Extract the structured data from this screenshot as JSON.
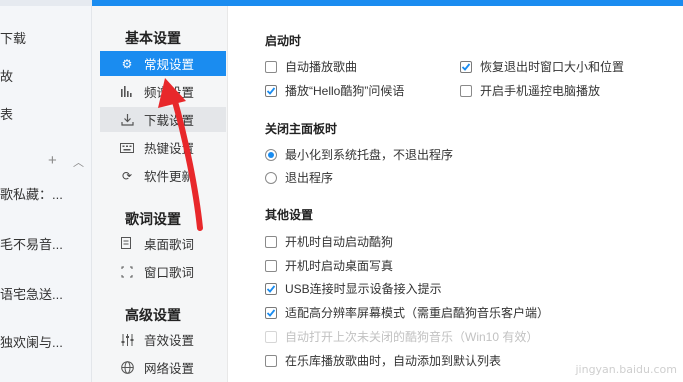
{
  "background_app": {
    "items": [
      "下载",
      "故",
      "表",
      "歌私藏：...",
      "毛不易音...",
      "语宅急送...",
      "独欢阑与..."
    ],
    "plus_icon": "plus-icon",
    "collapse_icon": "chevron-up-icon"
  },
  "sidebar": {
    "groups": [
      {
        "title": "基本设置",
        "items": [
          {
            "label": "常规设置",
            "icon": "gear-icon"
          },
          {
            "label": "频谱设置",
            "icon": "spectrum-icon"
          },
          {
            "label": "下载设置",
            "icon": "download-icon"
          },
          {
            "label": "热键设置",
            "icon": "keyboard-icon"
          },
          {
            "label": "软件更新",
            "icon": "refresh-icon"
          }
        ]
      },
      {
        "title": "歌词设置",
        "items": [
          {
            "label": "桌面歌词",
            "icon": "lyrics-desktop-icon"
          },
          {
            "label": "窗口歌词",
            "icon": "lyrics-window-icon"
          }
        ]
      },
      {
        "title": "高级设置",
        "items": [
          {
            "label": "音效设置",
            "icon": "equalizer-icon"
          },
          {
            "label": "网络设置",
            "icon": "network-icon"
          }
        ]
      }
    ],
    "active": "常规设置",
    "hovered": "下载设置"
  },
  "startup": {
    "title": "启动时",
    "options": [
      {
        "label": "自动播放歌曲",
        "checked": false
      },
      {
        "label": "恢复退出时窗口大小和位置",
        "checked": true
      },
      {
        "label": "播放“Hello酷狗”问候语",
        "checked": true
      },
      {
        "label": "开启手机遥控电脑播放",
        "checked": false
      }
    ]
  },
  "close_panel": {
    "title": "关闭主面板时",
    "options": [
      {
        "label": "最小化到系统托盘，不退出程序",
        "selected": true
      },
      {
        "label": "退出程序",
        "selected": false
      }
    ]
  },
  "other": {
    "title": "其他设置",
    "options": [
      {
        "label": "开机时自动启动酷狗",
        "checked": false,
        "disabled": false
      },
      {
        "label": "开机时启动桌面写真",
        "checked": false,
        "disabled": false
      },
      {
        "label": "USB连接时显示设备接入提示",
        "checked": true,
        "disabled": false
      },
      {
        "label": "适配高分辨率屏幕模式（需重启酷狗音乐客户端）",
        "checked": true,
        "disabled": false
      },
      {
        "label": "自动打开上次未关闭的酷狗音乐（Win10 有效）",
        "checked": false,
        "disabled": true
      },
      {
        "label": "在乐库播放歌曲时，自动添加到默认列表",
        "checked": false,
        "disabled": false
      }
    ]
  },
  "colors": {
    "accent": "#1a8cf0",
    "annotation_arrow": "#e8282b"
  },
  "watermark": "jingyan.baidu.com"
}
